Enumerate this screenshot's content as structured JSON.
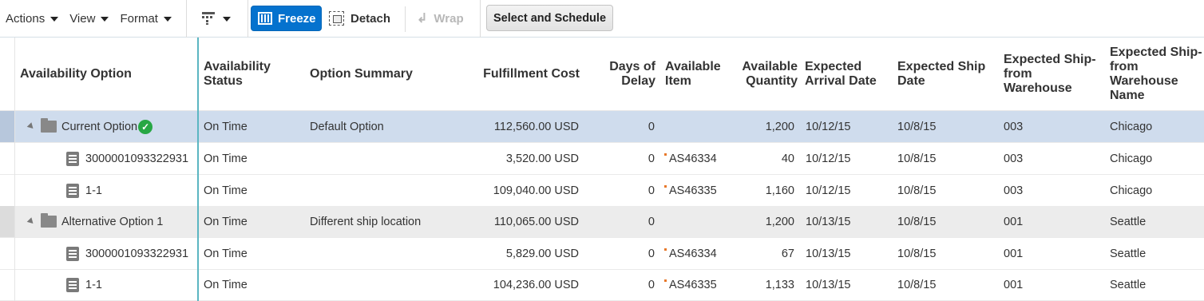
{
  "toolbar": {
    "menus": [
      {
        "label": "Actions"
      },
      {
        "label": "View"
      },
      {
        "label": "Format"
      }
    ],
    "freeze_label": "Freeze",
    "detach_label": "Detach",
    "wrap_label": "Wrap",
    "schedule_label": "Select and Schedule"
  },
  "columns": {
    "option": "Availability Option",
    "status": [
      "Availability",
      "Status"
    ],
    "summary": "Option Summary",
    "cost": "Fulfillment Cost",
    "delay": [
      "Days of",
      "Delay"
    ],
    "item": [
      "Available",
      "Item"
    ],
    "qty": [
      "Available",
      "Quantity"
    ],
    "arrival": [
      "Expected",
      "Arrival Date"
    ],
    "ship": [
      "Expected Ship",
      "Date"
    ],
    "warehouse": [
      "Expected Ship-",
      "from",
      "Warehouse"
    ],
    "warehouse_name": [
      "Expected Ship-",
      "from",
      "Warehouse",
      "Name"
    ]
  },
  "rows": [
    {
      "type": "group",
      "option": "Current Option",
      "status": "On Time",
      "summary": "Default Option",
      "cost": "112,560.00 USD",
      "delay": "0",
      "item": "",
      "qty": "1,200",
      "arrival": "10/12/15",
      "ship": "10/8/15",
      "warehouse": "003",
      "warehouse_name": "Chicago"
    },
    {
      "type": "line",
      "option": "3000001093322931",
      "status": "On Time",
      "summary": "",
      "cost": "3,520.00 USD",
      "delay": "0",
      "item": "AS46334",
      "qty": "40",
      "arrival": "10/12/15",
      "ship": "10/8/15",
      "warehouse": "003",
      "warehouse_name": "Chicago"
    },
    {
      "type": "line",
      "option": "1-1",
      "status": "On Time",
      "summary": "",
      "cost": "109,040.00 USD",
      "delay": "0",
      "item": "AS46335",
      "qty": "1,160",
      "arrival": "10/12/15",
      "ship": "10/8/15",
      "warehouse": "003",
      "warehouse_name": "Chicago"
    },
    {
      "type": "group",
      "option": "Alternative Option 1",
      "status": "On Time",
      "summary": "Different ship location",
      "cost": "110,065.00 USD",
      "delay": "0",
      "item": "",
      "qty": "1,200",
      "arrival": "10/13/15",
      "ship": "10/8/15",
      "warehouse": "001",
      "warehouse_name": "Seattle"
    },
    {
      "type": "line",
      "option": "3000001093322931",
      "status": "On Time",
      "summary": "",
      "cost": "5,829.00 USD",
      "delay": "0",
      "item": "AS46334",
      "qty": "67",
      "arrival": "10/13/15",
      "ship": "10/8/15",
      "warehouse": "001",
      "warehouse_name": "Seattle"
    },
    {
      "type": "line",
      "option": "1-1",
      "status": "On Time",
      "summary": "",
      "cost": "104,236.00 USD",
      "delay": "0",
      "item": "AS46335",
      "qty": "1,133",
      "arrival": "10/13/15",
      "ship": "10/8/15",
      "warehouse": "001",
      "warehouse_name": "Seattle"
    }
  ]
}
